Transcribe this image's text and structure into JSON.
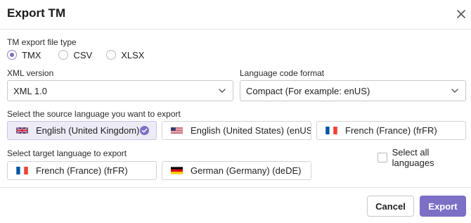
{
  "dialog": {
    "title": "Export TM",
    "close_icon": "close-icon"
  },
  "file_type": {
    "label": "TM export file type",
    "options": [
      {
        "label": "TMX",
        "checked": true
      },
      {
        "label": "CSV",
        "checked": false
      },
      {
        "label": "XLSX",
        "checked": false
      }
    ]
  },
  "xml_version": {
    "label": "XML version",
    "value": "XML 1.0"
  },
  "language_code_format": {
    "label": "Language code format",
    "value": "Compact (For example: enUS)"
  },
  "source_language": {
    "label": "Select the source language you want to export",
    "options": [
      {
        "label": "English (United Kingdom) ...",
        "flag": "uk-flag-icon",
        "selected": true
      },
      {
        "label": "English (United States) (enUS)",
        "flag": "us-flag-icon",
        "selected": false
      },
      {
        "label": "French (France) (frFR)",
        "flag": "france-flag-icon",
        "selected": false
      }
    ]
  },
  "target_language": {
    "label": "Select target language to export",
    "select_all_label": "Select all languages",
    "select_all_checked": false,
    "options": [
      {
        "label": "French (France) (frFR)",
        "flag": "france-flag-icon",
        "selected": false
      },
      {
        "label": "German (Germany) (deDE)",
        "flag": "germany-flag-icon",
        "selected": false
      }
    ]
  },
  "footer": {
    "cancel_label": "Cancel",
    "export_label": "Export"
  },
  "colors": {
    "accent": "#7b70c6",
    "selected_chip_bg": "#ecebf6"
  }
}
